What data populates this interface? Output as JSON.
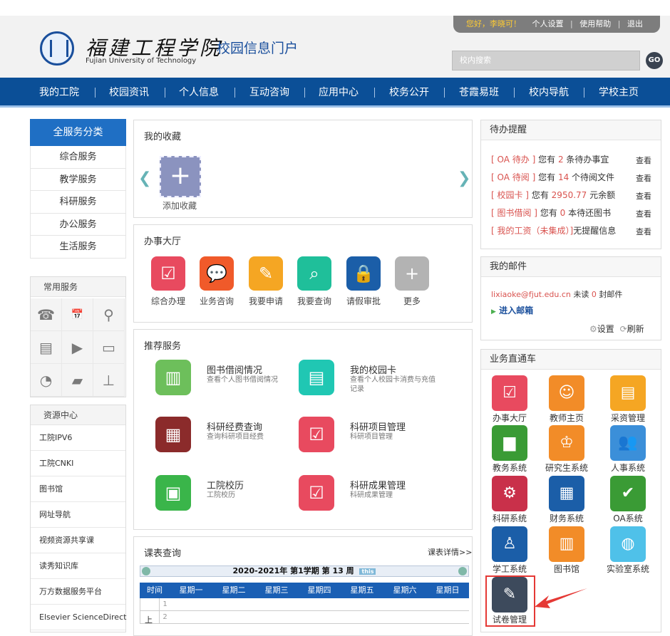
{
  "header": {
    "greeting": "您好，李晓可！",
    "links": [
      "个人设置",
      "使用帮助",
      "退出"
    ],
    "school_cn": "福建工程学院",
    "school_en": "Fujian University of Technology",
    "portal_title": "校园信息门户",
    "search_placeholder": "校内搜索",
    "go_label": "GO"
  },
  "nav": [
    "我的工院",
    "校园资讯",
    "个人信息",
    "互动咨询",
    "应用中心",
    "校务公开",
    "苍霞易班",
    "校内导航",
    "学校主页"
  ],
  "left": {
    "category_title": "全服务分类",
    "categories": [
      "综合服务",
      "教学服务",
      "科研服务",
      "办公服务",
      "生活服务"
    ],
    "common_title": "常用服务",
    "resource_title": "资源中心",
    "resources": [
      "工院IPV6",
      "工院CNKI",
      "图书馆",
      "网址导航",
      "视频资源共享课",
      "读秀知识库",
      "万方数据服务平台",
      "Elsevier ScienceDirect"
    ]
  },
  "favorites": {
    "title": "我的收藏",
    "add_label": "添加收藏"
  },
  "hall": {
    "title": "办事大厅",
    "items": [
      "综合办理",
      "业务咨询",
      "我要申请",
      "我要查询",
      "请假审批",
      "更多"
    ]
  },
  "recommend": {
    "title": "推荐服务",
    "items": [
      {
        "title": "图书借阅情况",
        "desc": "查看个人图书借阅情况"
      },
      {
        "title": "我的校园卡",
        "desc": "查看个人校园卡消费与充值记录"
      },
      {
        "title": "科研经费查询",
        "desc": "查询科研项目经费"
      },
      {
        "title": "科研项目管理",
        "desc": "科研项目管理"
      },
      {
        "title": "工院校历",
        "desc": "工院校历"
      },
      {
        "title": "科研成果管理",
        "desc": "科研成果管理"
      }
    ]
  },
  "schedule": {
    "title": "课表查询",
    "more": "课表详情>>",
    "term": "2020-2021年 第1学期 第 13 周",
    "this_week": "this",
    "headers": [
      "时间",
      "星期一",
      "星期二",
      "星期三",
      "星期四",
      "星期五",
      "星期六",
      "星期日"
    ],
    "period_label": "上",
    "rows": [
      "1",
      "2"
    ]
  },
  "todo": {
    "title": "待办提醒",
    "view": "查看",
    "items": [
      {
        "tag": "[ OA 待办 ]",
        "pre": "您有",
        "num": "2",
        "post": "条待办事宜"
      },
      {
        "tag": "[ OA 待阅 ]",
        "pre": "您有",
        "num": "14",
        "post": "个待阅文件"
      },
      {
        "tag": "[ 校园卡 ]",
        "pre": "您有",
        "num": "2950.77",
        "post": "元余额"
      },
      {
        "tag": "[ 图书借阅 ]",
        "pre": "您有",
        "num": "0",
        "post": "本待还图书"
      },
      {
        "tag": "[ 我的工资（未集成）]",
        "pre": "",
        "num": "",
        "post": "无提醒信息"
      }
    ]
  },
  "mail": {
    "title": "我的邮件",
    "address": "lixiaoke@fjut.edu.cn",
    "unread_pre": "未读",
    "unread_num": "0",
    "unread_post": "封邮件",
    "enter": "进入邮箱",
    "settings": "设置",
    "refresh": "刷新"
  },
  "bus": {
    "title": "业务直通车",
    "items": [
      "办事大厅",
      "教师主页",
      "采资管理",
      "教务系统",
      "研究生系统",
      "人事系统",
      "科研系统",
      "财务系统",
      "OA系统",
      "学工系统",
      "图书馆",
      "实验室系统",
      "试卷管理"
    ]
  },
  "colors": {
    "nav": "#0b4f97",
    "accent": "#1f6fc4",
    "alert": "#d9534f",
    "highlight": "#e53935"
  }
}
